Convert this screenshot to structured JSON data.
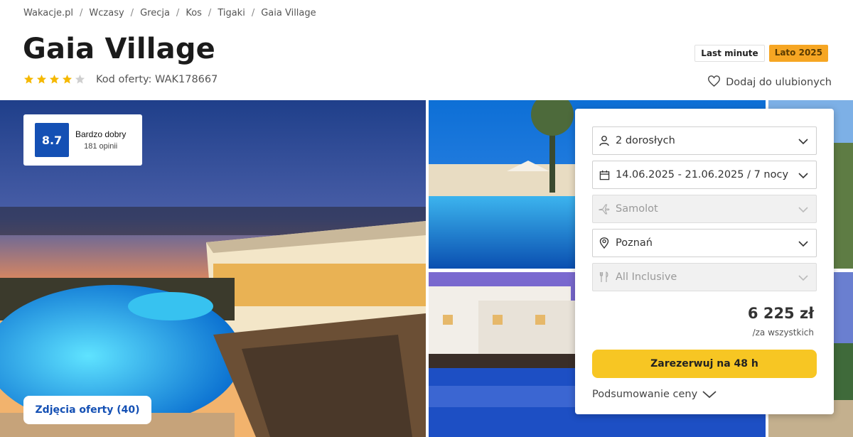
{
  "breadcrumb": [
    "Wakacje.pl",
    "Wczasy",
    "Grecja",
    "Kos",
    "Tigaki",
    "Gaia Village"
  ],
  "hotel": {
    "name": "Gaia Village",
    "stars": 4,
    "stars_max": 5,
    "offer_code": "Kod oferty: WAK178667"
  },
  "badges": {
    "last_minute": "Last minute",
    "season": "Lato 2025"
  },
  "favorite_label": "Dodaj do ulubionych",
  "rating": {
    "score": "8.7",
    "label": "Bardzo dobry",
    "reviews": "181 opinii"
  },
  "photos_button": "Zdjęcia oferty (40)",
  "booking": {
    "travelers": "2 dorosłych",
    "dates": "14.06.2025 - 21.06.2025 / 7 nocy",
    "transport": "Samolot",
    "departure": "Poznań",
    "board": "All Inclusive",
    "price": "6 225 zł",
    "price_note": "/za wszystkich",
    "book_button": "Zarezerwuj na 48 h",
    "summary_link": "Podsumowanie ceny"
  },
  "colors": {
    "accent_blue": "#1450b4",
    "book_yellow": "#f7c623",
    "season_orange": "#f6a623",
    "star_yellow": "#f5b800"
  },
  "icons": [
    "heart-icon",
    "user-icon",
    "calendar-icon",
    "plane-icon",
    "location-pin-icon",
    "cutlery-icon",
    "chevron-down-icon",
    "star-icon"
  ]
}
